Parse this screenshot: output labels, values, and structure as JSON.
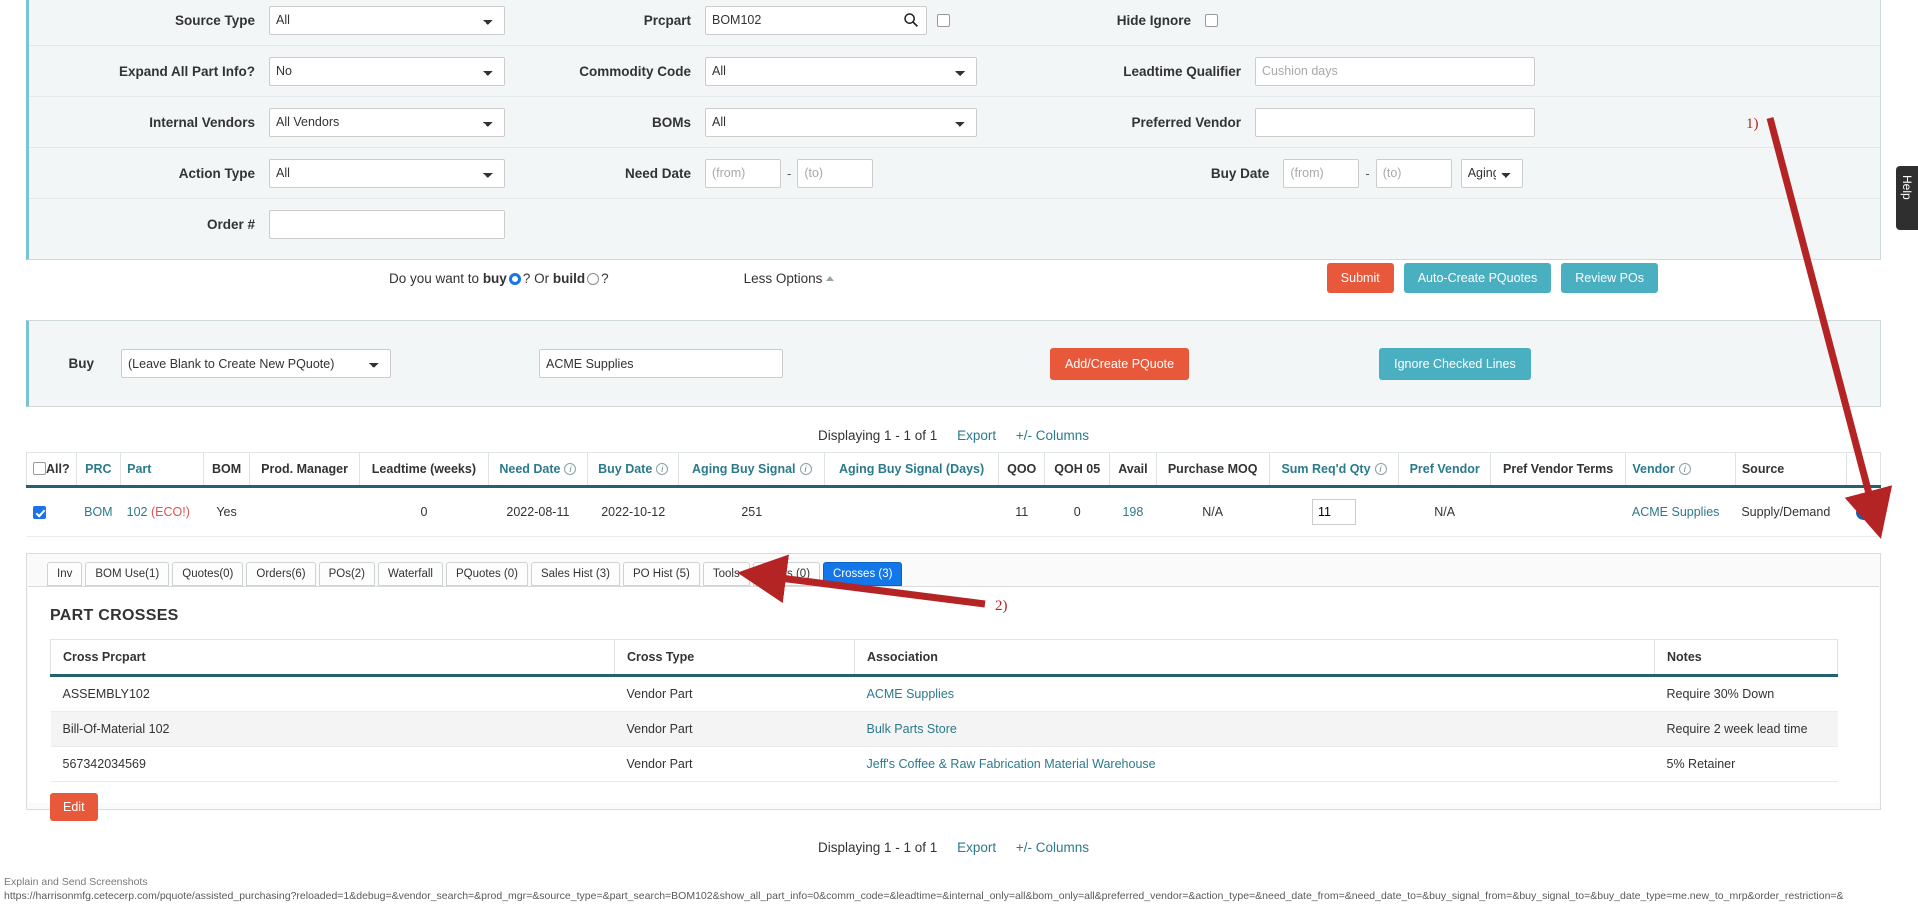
{
  "search_form": {
    "rows": [
      {
        "left_label": "Source Type",
        "left_value": "All",
        "mid_label": "Prcpart",
        "mid_value": "BOM102",
        "right_label": "Hide Ignore"
      },
      {
        "left_label": "Expand All Part Info?",
        "left_value": "No",
        "mid_label": "Commodity Code",
        "mid_value": "All",
        "right_label": "Leadtime Qualifier",
        "right_placeholder": "Cushion days"
      },
      {
        "left_label": "Internal Vendors",
        "left_value": "All Vendors",
        "mid_label": "BOMs",
        "mid_value": "All",
        "right_label": "Preferred Vendor",
        "right_value": ""
      },
      {
        "left_label": "Action Type",
        "left_value": "All",
        "mid_label": "Need Date",
        "from_placeholder": "(from)",
        "to_placeholder": "(to)",
        "right_label": "Buy Date",
        "aging_value": "Aging"
      },
      {
        "left_label": "Order #",
        "left_value": ""
      }
    ],
    "date_separator": "-"
  },
  "submit_row": {
    "question_prefix": "Do you want to ",
    "buy_word": "buy",
    "question_mid": "? Or ",
    "build_word": "build",
    "question_suffix": "?",
    "less_options": "Less Options",
    "submit_label": "Submit",
    "auto_create_label": "Auto-Create PQuotes",
    "review_pos_label": "Review POs"
  },
  "buy_panel": {
    "label": "Buy",
    "pquote_select_value": "(Leave Blank to Create New PQuote)",
    "vendor_value": "ACME Supplies",
    "add_create_label": "Add/Create PQuote",
    "ignore_lines_label": "Ignore Checked Lines"
  },
  "results": {
    "displaying": "Displaying 1 - 1 of 1",
    "export_label": "Export",
    "columns_label": "+/- Columns",
    "headers": [
      {
        "label": "All?",
        "teal": false,
        "info": false,
        "checkbox": true
      },
      {
        "label": "PRC",
        "teal": true,
        "info": false
      },
      {
        "label": "Part",
        "teal": true,
        "info": false
      },
      {
        "label": "BOM",
        "teal": false,
        "info": false
      },
      {
        "label": "Prod. Manager",
        "teal": false,
        "info": false
      },
      {
        "label": "Leadtime (weeks)",
        "teal": false,
        "info": false
      },
      {
        "label": "Need Date",
        "teal": true,
        "info": true
      },
      {
        "label": "Buy Date",
        "teal": true,
        "info": true
      },
      {
        "label": "Aging Buy Signal",
        "teal": true,
        "info": true
      },
      {
        "label": "Aging Buy Signal (Days)",
        "teal": true,
        "info": false
      },
      {
        "label": "QOO",
        "teal": false,
        "info": false
      },
      {
        "label": "QOH 05",
        "teal": false,
        "info": false
      },
      {
        "label": "Avail",
        "teal": false,
        "info": false
      },
      {
        "label": "Purchase MOQ",
        "teal": false,
        "info": false
      },
      {
        "label": "Sum Req'd Qty",
        "teal": true,
        "info": true
      },
      {
        "label": "Pref Vendor",
        "teal": true,
        "info": false
      },
      {
        "label": "Pref Vendor Terms",
        "teal": false,
        "info": false
      },
      {
        "label": "Vendor",
        "teal": true,
        "info": true
      },
      {
        "label": "Source",
        "teal": false,
        "info": false
      },
      {
        "label": "",
        "teal": false,
        "info": false
      }
    ],
    "row": {
      "checked": true,
      "prc": "BOM",
      "part_number": "102",
      "part_eco": "(ECO!)",
      "bom": "Yes",
      "prod_manager": "",
      "leadtime_weeks": "0",
      "need_date": "2022-08-11",
      "buy_date": "2022-10-12",
      "aging_buy_signal": "251",
      "aging_buy_signal_days": "",
      "qoo": "11",
      "qoh05": "0",
      "avail": "198",
      "purchase_moq": "N/A",
      "sum_reqd_qty": "11",
      "pref_vendor": "N/A",
      "pref_vendor_terms": "",
      "vendor": "ACME Supplies",
      "source": "Supply/Demand",
      "info_icon": "i"
    }
  },
  "detail": {
    "tabs": [
      {
        "label": "Inv",
        "active": false
      },
      {
        "label": "BOM Use(1)",
        "active": false
      },
      {
        "label": "Quotes(0)",
        "active": false
      },
      {
        "label": "Orders(6)",
        "active": false
      },
      {
        "label": "POs(2)",
        "active": false
      },
      {
        "label": "Waterfall",
        "active": false
      },
      {
        "label": "PQuotes (0)",
        "active": false
      },
      {
        "label": "Sales Hist (3)",
        "active": false
      },
      {
        "label": "PO Hist (5)",
        "active": false
      },
      {
        "label": "Tools",
        "active": false
      },
      {
        "label": "Notes (0)",
        "active": false
      },
      {
        "label": "Crosses (3)",
        "active": true
      }
    ],
    "panel_title": "PART CROSSES",
    "crosses_headers": [
      "Cross Prcpart",
      "Cross Type",
      "Association",
      "Notes"
    ],
    "crosses_rows": [
      {
        "cross_prcpart": "ASSEMBLY102",
        "cross_type": "Vendor Part",
        "association": "ACME Supplies",
        "notes": "Require 30% Down"
      },
      {
        "cross_prcpart": "Bill-Of-Material 102",
        "cross_type": "Vendor Part",
        "association": "Bulk Parts Store",
        "notes": "Require 2 week lead time"
      },
      {
        "cross_prcpart": "567342034569",
        "cross_type": "Vendor Part",
        "association": "Jeff's Coffee & Raw Fabrication Material Warehouse",
        "notes": "5% Retainer"
      }
    ],
    "edit_label": "Edit"
  },
  "results_bottom": {
    "displaying": "Displaying 1 - 1 of 1",
    "export_label": "Export",
    "columns_label": "+/- Columns"
  },
  "help_tab": {
    "label": "Help"
  },
  "statusbar": {
    "extension_text": "Explain and Send Screenshots",
    "url": "https://harrisonmfg.cetecerp.com/pquote/assisted_purchasing?reloaded=1&debug=&vendor_search=&prod_mgr=&source_type=&part_search=BOM102&show_all_part_info=0&comm_code=&leadtime=&internal_only=all&bom_only=all&preferred_vendor=&action_type=&need_date_from=&need_date_to=&buy_signal_from=&buy_signal_to=&buy_date_type=me.new_to_mrp&order_restriction=&"
  },
  "annotations": [
    {
      "label": "1)"
    },
    {
      "label": "2)"
    }
  ],
  "colors": {
    "accent_red": "#e8593c",
    "accent_teal": "#4aafc0",
    "link_teal": "#2b7a8c",
    "active_tab_blue": "#1277e8",
    "annotation_red": "#b52424"
  }
}
